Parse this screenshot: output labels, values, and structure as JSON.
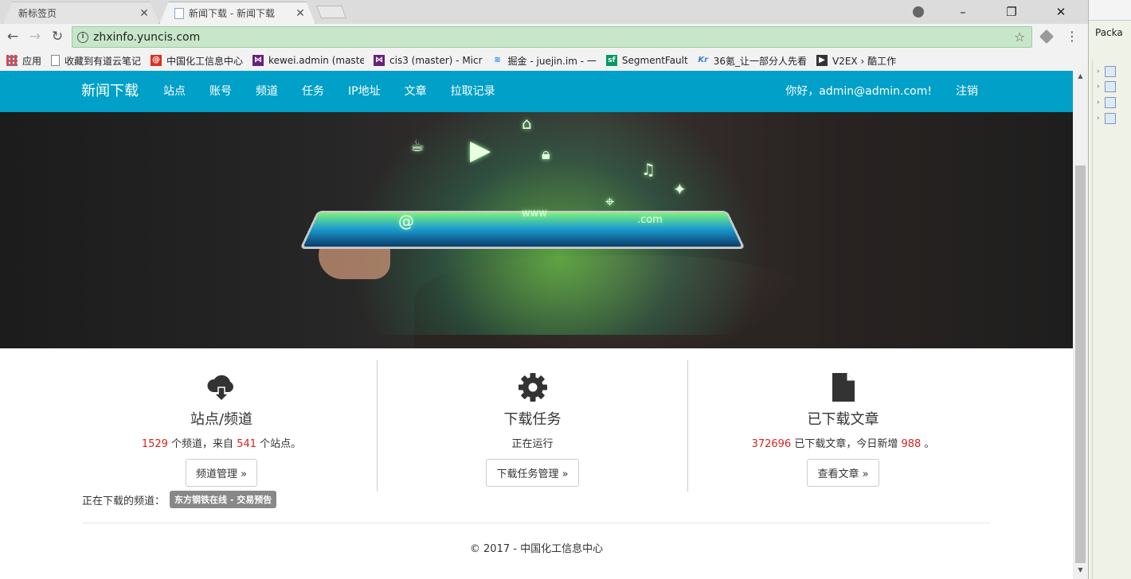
{
  "browser": {
    "tabs": [
      {
        "title": "新标签页",
        "active": false
      },
      {
        "title": "新闻下载 - 新闻下载",
        "active": true
      }
    ],
    "url": "zhxinfo.yuncis.com",
    "window_controls": {
      "minimize": "–",
      "restore": "❐",
      "close": "✕"
    },
    "bookmarks": [
      {
        "label": "应用",
        "icon": "apps-grid-icon",
        "color": "#e8453c"
      },
      {
        "label": "收藏到有道云笔记",
        "icon": "page-icon",
        "color": "#888888"
      },
      {
        "label": "中国化工信息中心",
        "icon": "at-icon",
        "color": "#d93025"
      },
      {
        "label": "kewei.admin (maste",
        "icon": "visual-studio-icon",
        "color": "#68217a"
      },
      {
        "label": "cis3 (master) - Micr",
        "icon": "visual-studio-icon",
        "color": "#68217a"
      },
      {
        "label": "掘金 - juejin.im - 一",
        "icon": "juejin-icon",
        "color": "#1e80ff"
      },
      {
        "label": "SegmentFault",
        "icon": "segmentfault-icon",
        "color": "#009a61"
      },
      {
        "label": "36氪_让一部分人先看",
        "icon": "kr-icon",
        "color": "#3b7ddd"
      },
      {
        "label": "V2EX › 酷工作",
        "icon": "v2ex-icon",
        "color": "#333333"
      }
    ]
  },
  "navbar": {
    "brand": "新闻下载",
    "links": [
      "站点",
      "账号",
      "频道",
      "任务",
      "IP地址",
      "文章",
      "拉取记录"
    ],
    "greeting": "你好，admin@admin.com!",
    "logout": "注销",
    "color": "#00a0c8"
  },
  "stats": {
    "sites": {
      "icon": "cloud-download-icon",
      "title": "站点/频道",
      "channel_count": "1529",
      "text_a": " 个频道，来自 ",
      "site_count": "541",
      "text_b": " 个站点。",
      "button": "频道管理 »"
    },
    "tasks": {
      "icon": "gear-icon",
      "title": "下载任务",
      "status": "正在运行",
      "button": "下载任务管理 »"
    },
    "articles": {
      "icon": "file-icon",
      "title": "已下载文章",
      "article_count": "372696",
      "text_a": " 已下载文章，今日新增 ",
      "today_count": "988",
      "text_b": " 。",
      "button": "查看文章 »"
    }
  },
  "downloading": {
    "label": "正在下载的频道：",
    "channel": "东方钢铁在线 - 交易预告"
  },
  "footer": "© 2017 - 中国化工信息中心",
  "ide_panel": {
    "label": "Packa"
  },
  "colors": {
    "accent": "#00a0c8",
    "highlight_number": "#d9231d",
    "omnibox_bg": "#c8e6c9"
  }
}
